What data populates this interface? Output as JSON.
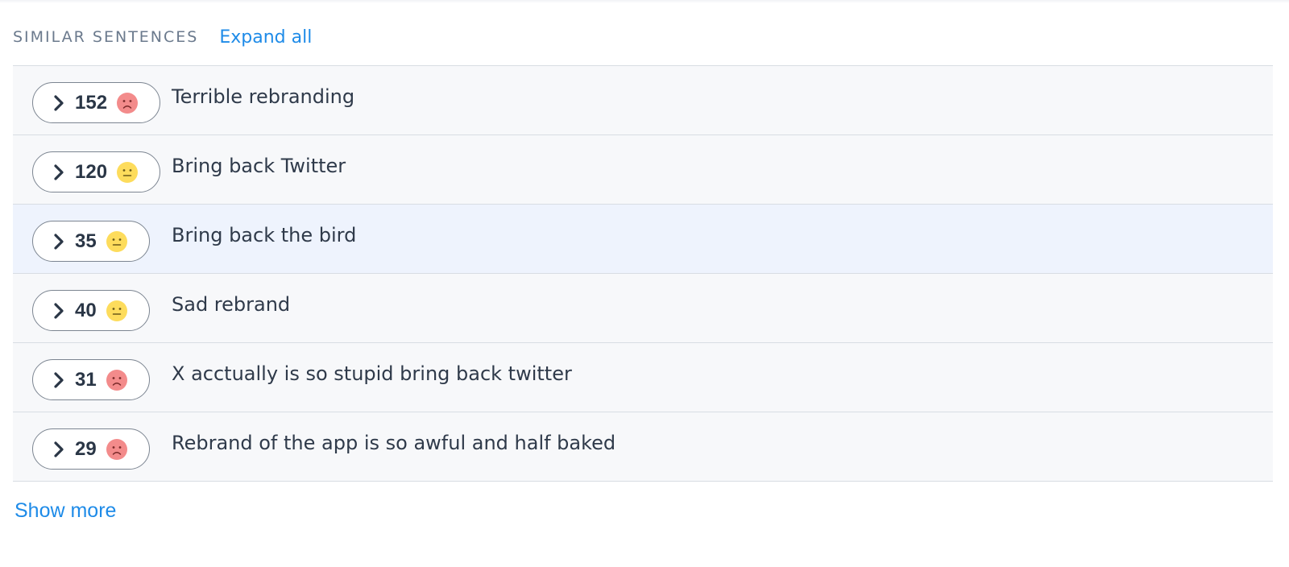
{
  "header": {
    "title": "SIMILAR SENTENCES",
    "expand_label": "Expand all"
  },
  "colors": {
    "accent": "#1e8be8",
    "negative": "#f38b8b",
    "neutral": "#fddc5c",
    "row_bg": "#f7f8fa",
    "row_highlight_bg": "#eef3fd"
  },
  "rows": [
    {
      "count": "152",
      "sentiment": "negative",
      "sentiment_icon": "sad-face-icon",
      "text": "Terrible rebranding"
    },
    {
      "count": "120",
      "sentiment": "neutral",
      "sentiment_icon": "neutral-face-icon",
      "text": "Bring back Twitter"
    },
    {
      "count": "35",
      "sentiment": "neutral",
      "sentiment_icon": "neutral-face-icon",
      "text": "Bring back the bird"
    },
    {
      "count": "40",
      "sentiment": "neutral",
      "sentiment_icon": "neutral-face-icon",
      "text": "Sad rebrand"
    },
    {
      "count": "31",
      "sentiment": "negative",
      "sentiment_icon": "sad-face-icon",
      "text": "X acctually is so stupid bring back twitter"
    },
    {
      "count": "29",
      "sentiment": "negative",
      "sentiment_icon": "sad-face-icon",
      "text": "Rebrand of the app is so awful and half baked"
    }
  ],
  "footer": {
    "show_more_label": "Show more"
  }
}
